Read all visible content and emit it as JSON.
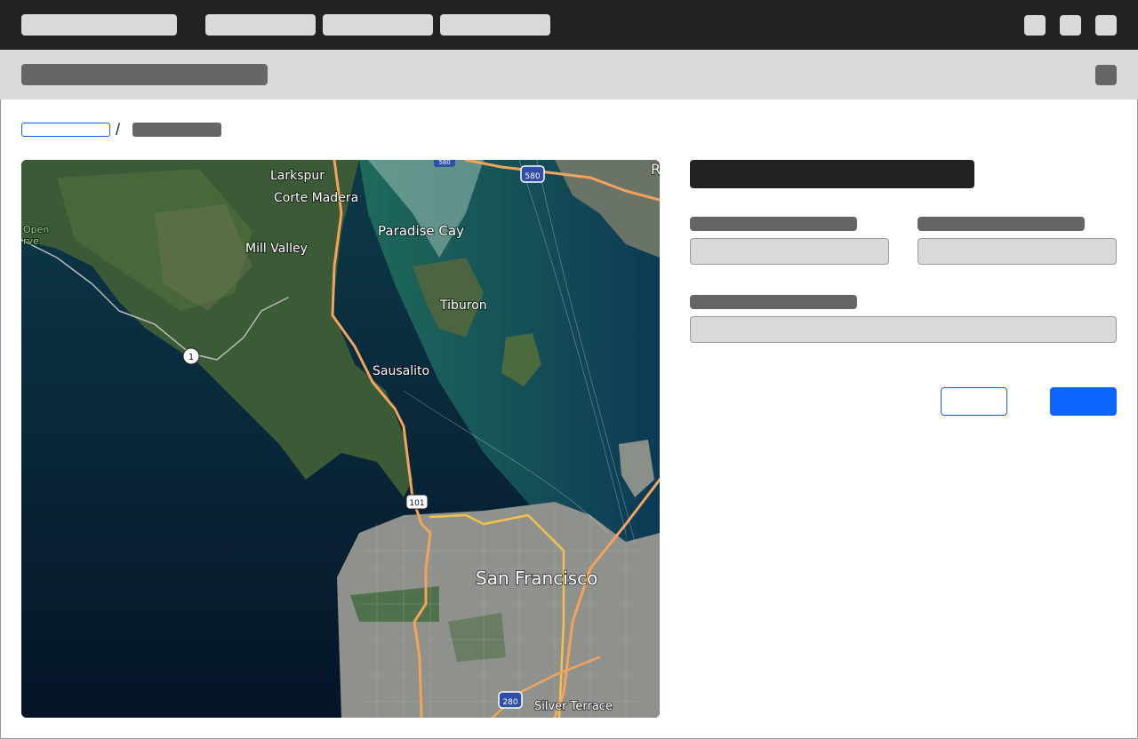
{
  "app": {
    "colors": {
      "topbar": "#222222",
      "subheader": "#d9d9d9",
      "placeholder_dark": "#666666",
      "placeholder_light": "#d9d9d9",
      "accent": "#0a66ff",
      "link": "#1a63d6"
    }
  },
  "breadcrumb": {
    "separator": "/"
  },
  "map": {
    "labels": {
      "larkspur": "Larkspur",
      "corte_madera": "Corte Madera",
      "mill_valley": "Mill Valley",
      "paradise_cay": "Paradise Cay",
      "tiburon": "Tiburon",
      "sausalito": "Sausalito",
      "san_francisco": "San Francisco",
      "silver_terrace": "Silver Terrace",
      "open_space_1": "Open",
      "open_space_2": "rve",
      "edge_r": "R"
    },
    "shields": {
      "hwy1": "1",
      "us101": "101",
      "i580_top": "580",
      "i580": "580",
      "i280": "280"
    }
  }
}
